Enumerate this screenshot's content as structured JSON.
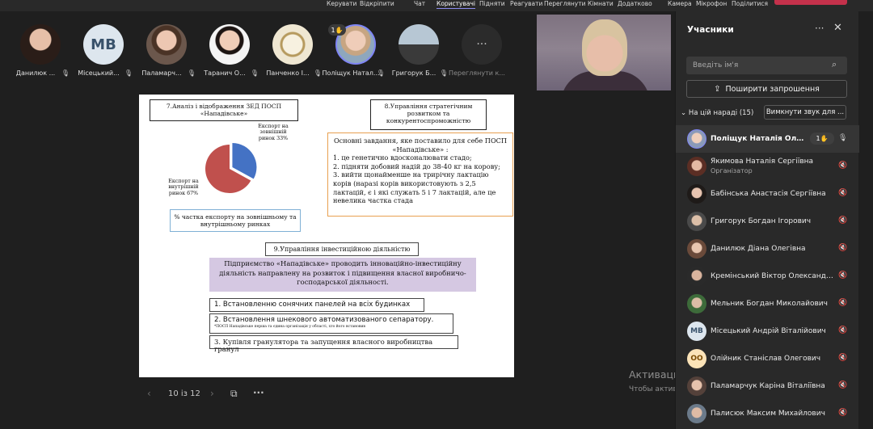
{
  "toolbar": {
    "items": [
      "Керувати",
      "Відкріпити",
      "Чат",
      "Користувачі",
      "Підняти",
      "Реагувати",
      "Переглянути",
      "Кімнати",
      "Додатково",
      "Камера",
      "Мікрофон",
      "Поділитися"
    ]
  },
  "strip": {
    "tiles": [
      {
        "name": "Данилюк ...",
        "initials": ""
      },
      {
        "name": "Місецький...",
        "initials": "MB"
      },
      {
        "name": "Паламарч...",
        "initials": ""
      },
      {
        "name": "Таранич О...",
        "initials": ""
      },
      {
        "name": "Панченко І...",
        "initials": ""
      },
      {
        "name": "Поліщук Натал...",
        "initials": "",
        "badge": "1✋"
      },
      {
        "name": "Григорук Б...",
        "initials": ""
      },
      {
        "name": "Переглянути к...",
        "initials": "···"
      }
    ]
  },
  "slide": {
    "box1": "7.Аналіз і відображення ЗЕД ПОСП «Нападівське»",
    "box2": "8.Управління стратегічним розвитком та конкурентоспроможністю",
    "box3_title": "Основні завдання, яке поставило для себе ПОСП «Нападівське» :",
    "box3_items": [
      "1. це генетично вдосконалювати стадо;",
      "2. підняти добовий надій до 38-40 кг на корову;",
      "3. вийти щонайменше на трирічну лактацію корів (наразі корів використовують з 2,5 лактацій, є і які служать 5 і 7 лактацій, але це невелика частка стада"
    ],
    "box4": "% частка експорту на зовнішньому та внутрішньому ринках",
    "box5": "9.Управління інвестиційною діяльністю",
    "box6": "Підприємство «Нападівське» проводить інноваційно-інвестиційну діяльність направлену на розвиток і підвищення власної виробничо-господарської діяльності.",
    "box7": "1. Встановленню сонячних панелей на всіх будинках",
    "box8_main": "2. Встановлення шнекового автоматизованого сепаратору.",
    "box8_note": "*ПОСП Нападівське перша та єдина організація у області, хто його встановив",
    "box9": "3. Купівля гранулятора та запущення власного виробництва гранул",
    "pie_label_external": "Експорт на зовнішній ринок 33%",
    "pie_label_internal": "Експорт на внутрішній ринок 67%"
  },
  "chart_data": {
    "type": "pie",
    "categories": [
      "Експорт на зовнішній ринок",
      "Експорт на внутрішній ринок"
    ],
    "values": [
      33,
      67
    ],
    "colors": [
      "#4472c4",
      "#c0504d"
    ],
    "title": ""
  },
  "slidenav": {
    "counter": "10 із 12",
    "more": "···"
  },
  "watermark": {
    "title": "Активация Windows",
    "line": "Чтобы активировать Windows, перейдите в раздел \"Параметры\"."
  },
  "panel": {
    "title": "Учасники",
    "more": "···",
    "search_placeholder": "Введіть ім'я",
    "share_label": "Поширити запрошення",
    "section_label": "На цій нараді (15)",
    "mute_all_label": "Вимкнути звук для ...",
    "participants": [
      {
        "name": "Поліщук Наталія Олекс...",
        "role": "",
        "badge": "1✋",
        "highlight": true
      },
      {
        "name": "Якимова Наталія Сергіївна",
        "role": "Організатор"
      },
      {
        "name": "Бабінська Анастасія Сергіївна",
        "role": ""
      },
      {
        "name": "Григорук Богдан Ігорович",
        "role": ""
      },
      {
        "name": "Данилюк Діана Олегівна",
        "role": ""
      },
      {
        "name": "Кремінський Віктор Олександр...",
        "role": ""
      },
      {
        "name": "Мельник Богдан Миколайович",
        "role": ""
      },
      {
        "name": "Місецький Андрій Віталійович",
        "role": "",
        "initials": "MB"
      },
      {
        "name": "Олійник Станіслав Олегович",
        "role": "",
        "initials": "OO"
      },
      {
        "name": "Паламарчук Каріна Віталіївна",
        "role": ""
      },
      {
        "name": "Палисюк Максим Михайлович",
        "role": ""
      }
    ]
  }
}
